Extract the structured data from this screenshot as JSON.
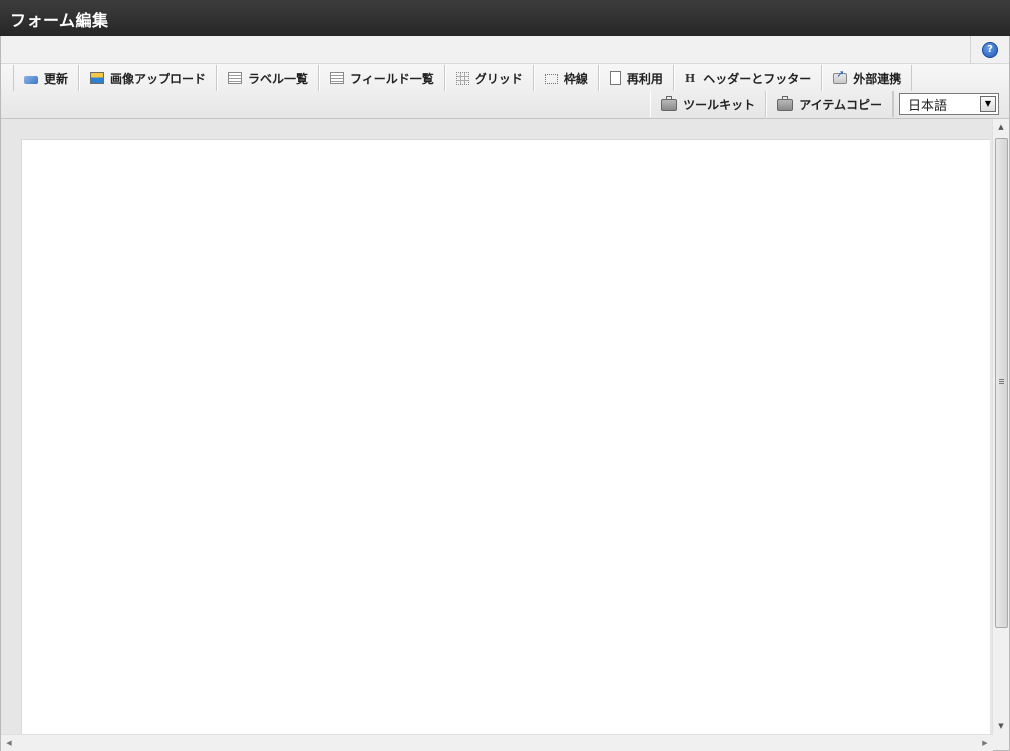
{
  "window": {
    "title": "フォーム編集"
  },
  "help": {
    "icon": "help-icon",
    "glyph": "?"
  },
  "toolbar": {
    "row1": [
      {
        "id": "update",
        "label": "更新",
        "icon": "refresh-icon"
      },
      {
        "id": "image-upload",
        "label": "画像アップロード",
        "icon": "image-upload-icon"
      },
      {
        "id": "label-list",
        "label": "ラベル一覧",
        "icon": "list-icon"
      },
      {
        "id": "field-list",
        "label": "フィールド一覧",
        "icon": "list-icon"
      },
      {
        "id": "grid",
        "label": "グリッド",
        "icon": "grid-icon"
      },
      {
        "id": "frame-lines",
        "label": "枠線",
        "icon": "frame-icon"
      },
      {
        "id": "reuse",
        "label": "再利用",
        "icon": "copy-icon"
      },
      {
        "id": "header-footer",
        "label": "ヘッダーとフッター",
        "icon": "header-icon",
        "icon_glyph": "H"
      },
      {
        "id": "external-link",
        "label": "外部連携",
        "icon": "export-icon"
      }
    ],
    "row2": [
      {
        "id": "toolkit",
        "label": "ツールキット",
        "icon": "toolkit-icon"
      },
      {
        "id": "item-copy",
        "label": "アイテムコピー",
        "icon": "toolkit-icon"
      }
    ],
    "language": {
      "selected": "日本語",
      "arrow": "▼"
    }
  },
  "scrollbar": {
    "up": "▲",
    "down": "▼",
    "left": "◀",
    "right": "▶"
  },
  "colors": {
    "titlebar": "#2b2b2b",
    "toolbar": "#ececec",
    "workspace": "#e6e6e6",
    "canvas": "#ffffff",
    "help_accent": "#1f58b8"
  }
}
